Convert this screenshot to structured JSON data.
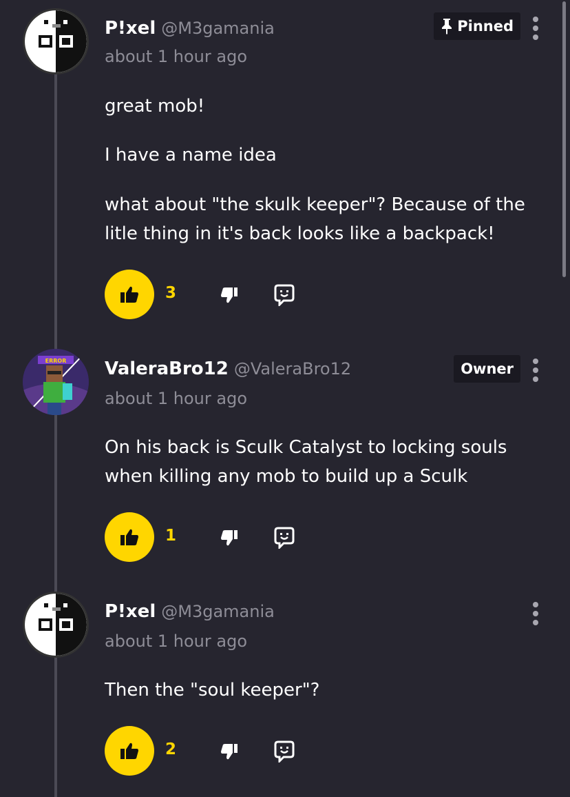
{
  "comments": [
    {
      "name": "P!xel",
      "handle": "@M3gamania",
      "time": "about 1 hour ago",
      "badge": "Pinned",
      "paragraphs": [
        "great mob!",
        "I have a name idea",
        "what about \"the skulk keeper\"? Because of the litle thing in it's back looks like a backpack!"
      ],
      "likes": "3"
    },
    {
      "name": "ValeraBro12",
      "handle": "@ValeraBro12",
      "time": "about 1 hour ago",
      "badge": "Owner",
      "avatar_label": "ERROR",
      "paragraphs": [
        "On his back is Sculk Catalyst to locking souls when killing any mob to build up a Sculk"
      ],
      "likes": "1"
    },
    {
      "name": "P!xel",
      "handle": "@M3gamania",
      "time": "about 1 hour ago",
      "paragraphs": [
        "Then the \"soul keeper\"?"
      ],
      "likes": "2"
    }
  ],
  "icons": {
    "like": "thumbs-up-icon",
    "dislike": "thumbs-down-icon",
    "reply": "reply-icon",
    "pin": "pin-icon",
    "more": "kebab-menu-icon"
  },
  "colors": {
    "background": "#26252f",
    "accent": "#ffd600",
    "muted": "#8e8d97",
    "badge_bg": "#1a1921"
  }
}
